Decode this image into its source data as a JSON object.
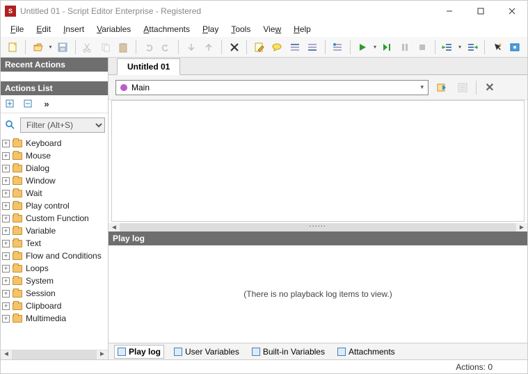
{
  "title": "Untitled 01 - Script Editor  Enterprise - Registered",
  "menus": [
    "File",
    "Edit",
    "Insert",
    "Variables",
    "Attachments",
    "Play",
    "Tools",
    "View",
    "Help"
  ],
  "recent_actions_hdr": "Recent Actions",
  "actions_list_hdr": "Actions List",
  "filter_placeholder": "Filter (Alt+S)",
  "tree_items": [
    "Keyboard",
    "Mouse",
    "Dialog",
    "Window",
    "Wait",
    "Play control",
    "Custom Function",
    "Variable",
    "Text",
    "Flow and Conditions",
    "Loops",
    "System",
    "Session",
    "Clipboard",
    "Multimedia"
  ],
  "tab_label": "Untitled 01",
  "combo_value": "Main",
  "playlog_hdr": "Play log",
  "playlog_empty": "(There is no playback log items to view.)",
  "bottom_tabs": [
    "Play log",
    "User Variables",
    "Built-in Variables",
    "Attachments"
  ],
  "status": "Actions: 0"
}
